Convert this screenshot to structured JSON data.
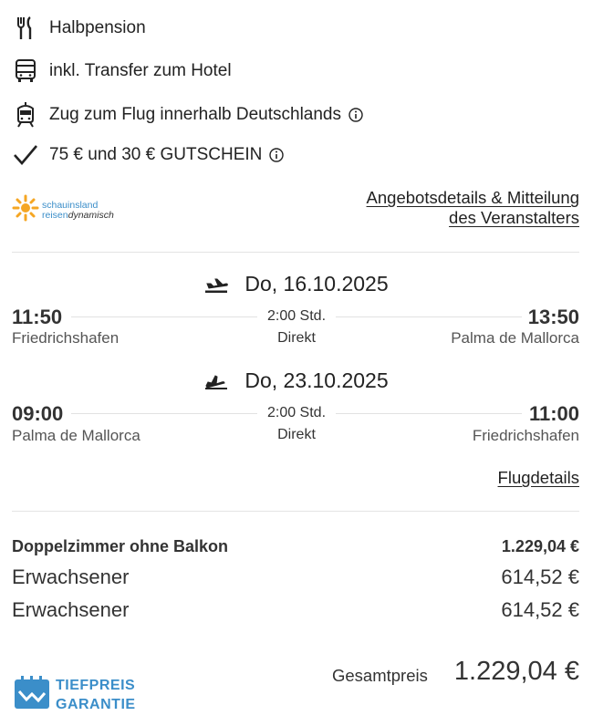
{
  "features": [
    {
      "icon": "cutlery-icon",
      "text": "Halbpension"
    },
    {
      "icon": "bus-icon",
      "text": "inkl. Transfer zum Hotel"
    },
    {
      "icon": "train-icon",
      "text": "Zug zum Flug innerhalb Deutschlands"
    },
    {
      "icon": "checkmark-icon",
      "text": "75 € und 30 € GUTSCHEIN"
    }
  ],
  "provider": {
    "logo_line1": "schauinsland",
    "logo_line2a": "reisen",
    "logo_line2b": "dynamisch",
    "offer_link_line1": "Angebotsdetails & Mitteilung",
    "offer_link_line2": "des Veranstalters"
  },
  "legs": [
    {
      "direction_icon": "plane-departure-icon",
      "date": "Do, 16.10.2025",
      "dep_time": "11:50",
      "dep_place": "Friedrichshafen",
      "duration": "2:00 Std.",
      "stops": "Direkt",
      "arr_time": "13:50",
      "arr_place": "Palma de Mallorca"
    },
    {
      "direction_icon": "plane-arrival-icon",
      "date": "Do, 23.10.2025",
      "dep_time": "09:00",
      "dep_place": "Palma de Mallorca",
      "duration": "2:00 Std.",
      "stops": "Direkt",
      "arr_time": "11:00",
      "arr_place": "Friedrichshafen"
    }
  ],
  "flight_details_link": "Flugdetails",
  "pricing": {
    "room_name": "Doppelzimmer ohne Balkon",
    "room_price": "1.229,04 €",
    "passengers": [
      {
        "label": "Erwachsener",
        "price": "614,52 €"
      },
      {
        "label": "Erwachsener",
        "price": "614,52 €"
      }
    ],
    "total_label": "Gesamtpreis",
    "total_value": "1.229,04 €"
  },
  "guarantee": {
    "line1": "TIEFPREIS",
    "line2": "GARANTIE"
  },
  "colors": {
    "brand_blue": "#3b8ec9",
    "text": "#222222",
    "divider": "#e4e4e4"
  }
}
